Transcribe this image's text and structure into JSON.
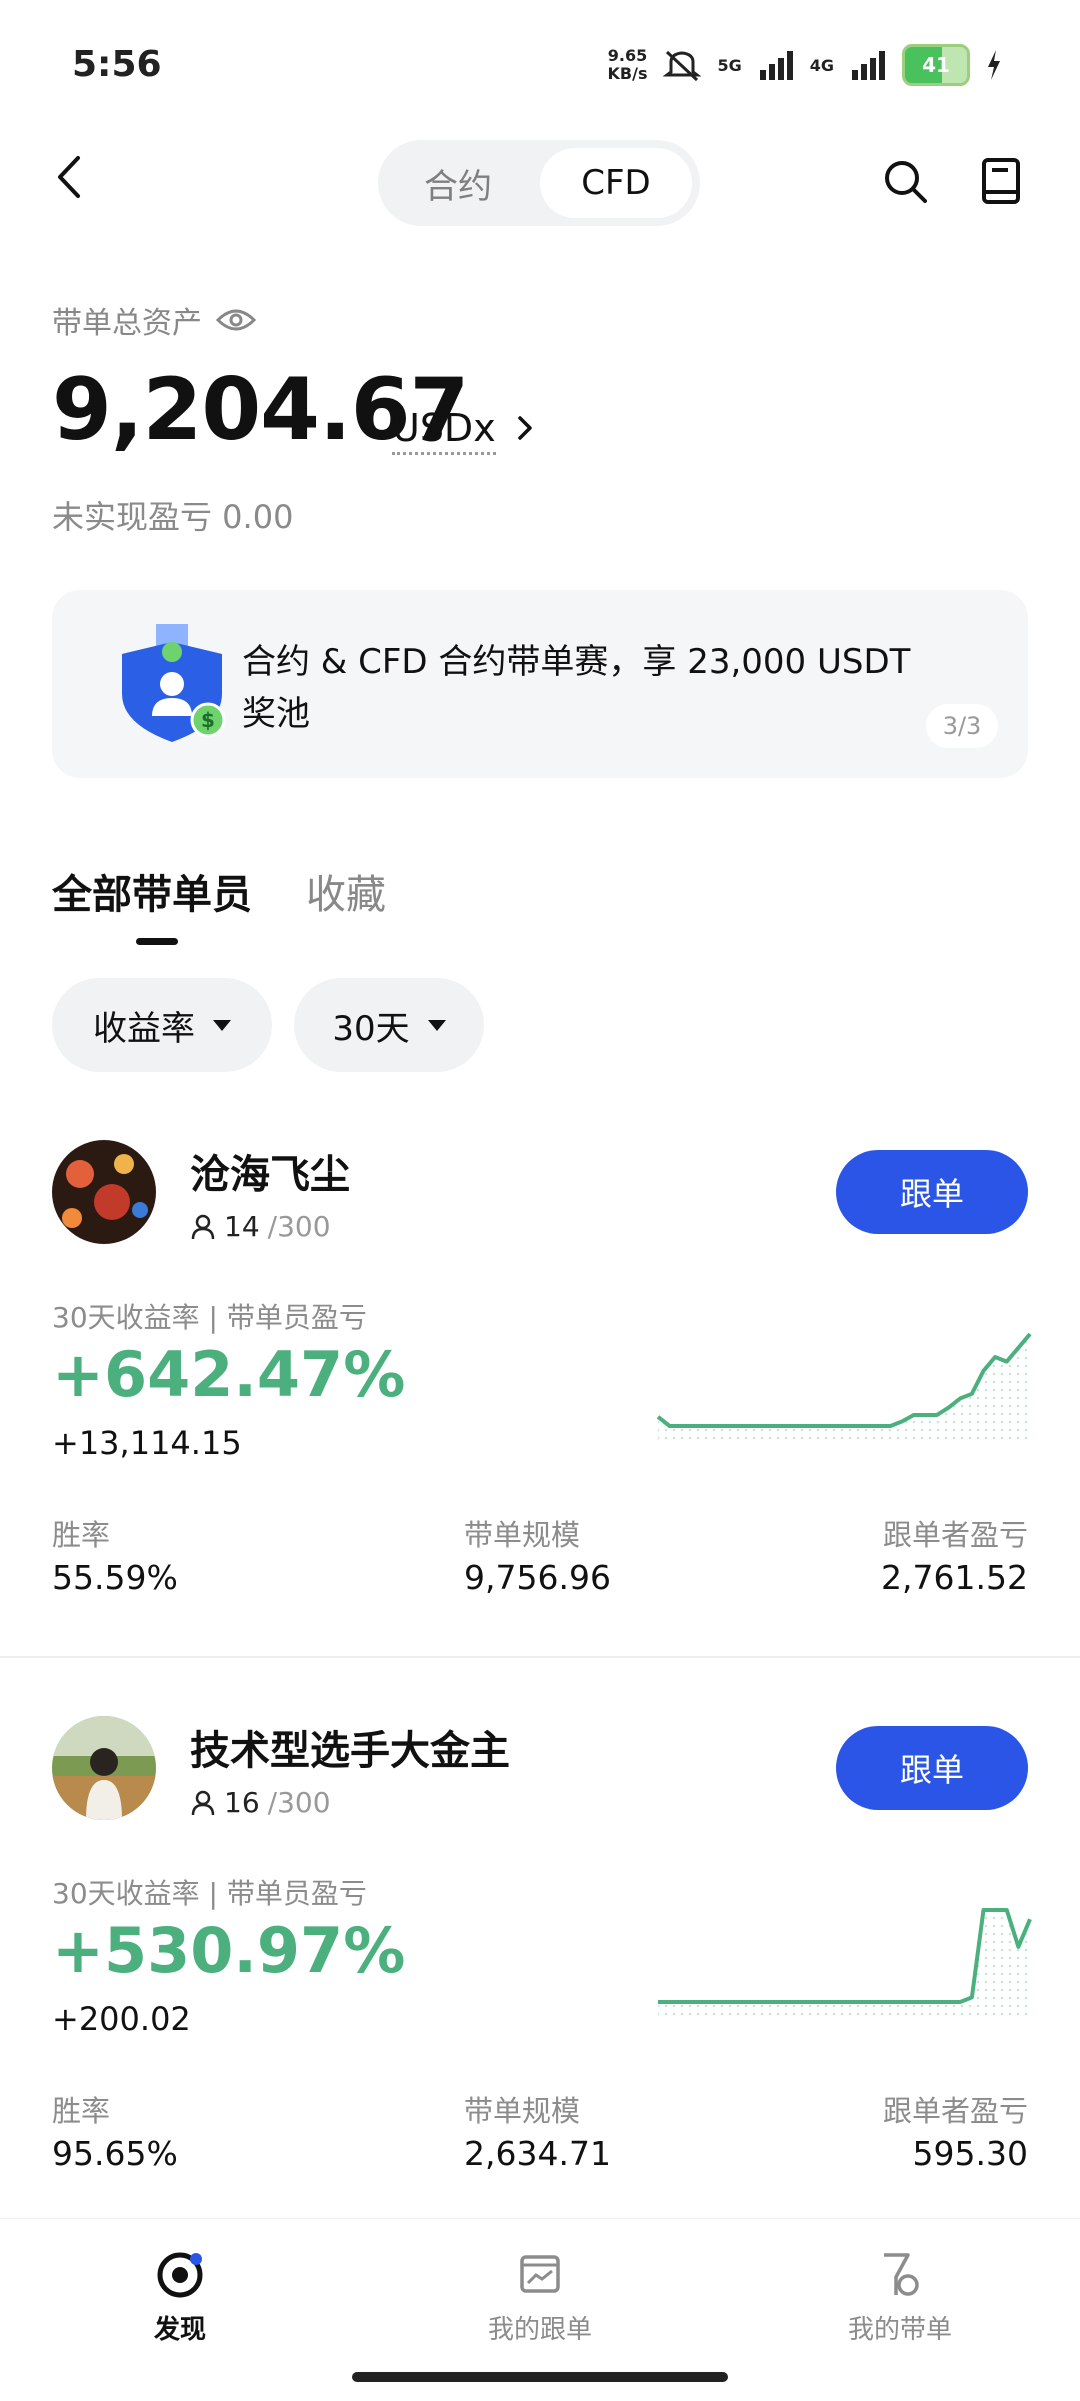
{
  "status_bar": {
    "time": "5:56",
    "speed_top": "9.65",
    "speed_bottom": "KB/s",
    "net1": "5G",
    "net2": "4G",
    "battery": "41"
  },
  "header": {
    "tabs": [
      "合约",
      "CFD"
    ],
    "active_tab": "CFD"
  },
  "asset": {
    "title": "带单总资产",
    "value": "9,204.67",
    "unit": "USDx",
    "unrealized": "未实现盈亏 0.00"
  },
  "banner": {
    "text": "合约 & CFD 合约带单赛，享 23,000 USDT 奖池",
    "pager": "3/3"
  },
  "list_tabs": {
    "all": "全部带单员",
    "favorites": "收藏"
  },
  "filters": {
    "sort": "收益率",
    "period": "30天"
  },
  "traders": [
    {
      "name": "沧海飞尘",
      "followers": "14",
      "capacity": "/300",
      "follow_label": "跟单",
      "sub_label": "30天收益率 | 带单员盈亏",
      "roi": "+642.47%",
      "pnl": "+13,114.15",
      "stats": [
        {
          "label": "胜率",
          "value": "55.59%"
        },
        {
          "label": "带单规模",
          "value": "9,756.96"
        },
        {
          "label": "跟单者盈亏",
          "value": "2,761.52"
        }
      ],
      "spark": [
        0.1,
        0.0,
        0.0,
        0.0,
        0.0,
        0.0,
        0.0,
        0.0,
        0.0,
        0.0,
        0.0,
        0.0,
        0.0,
        0.0,
        0.0,
        0.0,
        0.0,
        0.0,
        0.0,
        0.0,
        0.0,
        0.05,
        0.12,
        0.12,
        0.12,
        0.2,
        0.3,
        0.35,
        0.6,
        0.75,
        0.7,
        0.85,
        1.0
      ]
    },
    {
      "name": "技术型选手大金主",
      "followers": "16",
      "capacity": "/300",
      "follow_label": "跟单",
      "sub_label": "30天收益率 | 带单员盈亏",
      "roi": "+530.97%",
      "pnl": "+200.02",
      "stats": [
        {
          "label": "胜率",
          "value": "95.65%"
        },
        {
          "label": "带单规模",
          "value": "2,634.71"
        },
        {
          "label": "跟单者盈亏",
          "value": "595.30"
        }
      ],
      "spark": [
        0,
        0,
        0,
        0,
        0,
        0,
        0,
        0,
        0,
        0,
        0,
        0,
        0,
        0,
        0,
        0,
        0,
        0,
        0,
        0,
        0,
        0,
        0,
        0,
        0,
        0,
        0,
        0.05,
        1.0,
        1.0,
        1.0,
        0.6,
        0.9
      ]
    }
  ],
  "bottom_nav": [
    {
      "label": "发现",
      "icon": "discover-icon",
      "active": true
    },
    {
      "label": "我的跟单",
      "icon": "copy-trade-icon",
      "active": false
    },
    {
      "label": "我的带单",
      "icon": "lead-trade-icon",
      "active": false
    }
  ],
  "colors": {
    "accent_blue": "#2b55e6",
    "profit_green": "#4cb07e"
  }
}
